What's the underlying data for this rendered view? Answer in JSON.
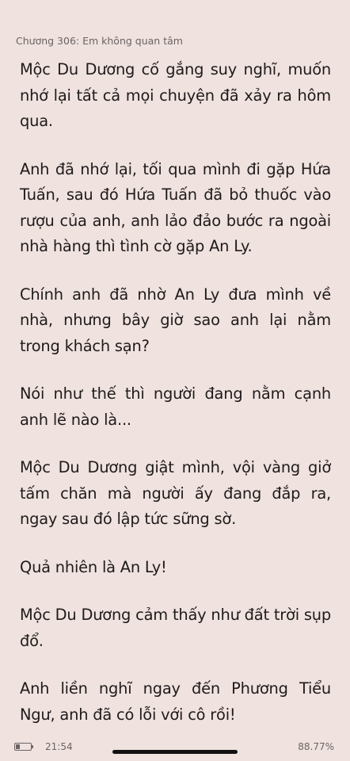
{
  "header": {
    "chapter_title": "Chương 306: Em không quan tâm"
  },
  "paragraphs": [
    "Mộc Du Dương cố gắng suy nghĩ, muốn nhớ lại tất cả mọi chuyện đã xảy ra hôm qua.",
    "Anh đã nhớ lại, tối qua mình đi gặp Hứa Tuấn, sau đó Hứa Tuấn đã bỏ thuốc vào rượu của anh, anh lảo đảo bước ra ngoài nhà hàng thì tình cờ gặp An Ly.",
    "Chính anh đã nhờ An Ly đưa mình về nhà, nhưng bây giờ sao anh lại nằm trong khách sạn?",
    "Nói như thế thì người đang nằm cạnh anh lẽ nào là...",
    "Mộc Du Dương giật mình, vội vàng giở tấm chăn mà người ấy đang đắp ra, ngay sau đó lập tức sững sờ.",
    "Quả nhiên là An Ly!",
    "Mộc Du Dương cảm thấy như đất trời sụp đổ.",
    "Anh liền nghĩ ngay đến Phương Tiểu Ngư, anh đã có lỗi với cô rồi!"
  ],
  "status_bar": {
    "time": "21:54",
    "reading_progress": "88.77%",
    "battery_level": 0.3,
    "battery_icon": "battery-icon"
  },
  "colors": {
    "background": "#efe2df",
    "text": "#1f1b1b",
    "muted": "#6b6464"
  }
}
